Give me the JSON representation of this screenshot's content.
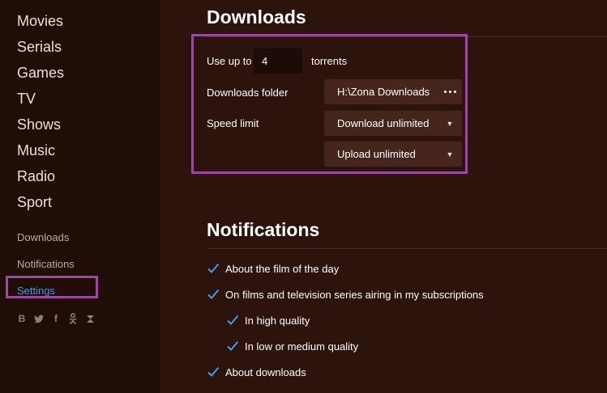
{
  "sidebar": {
    "main_items": [
      "Movies",
      "Serials",
      "Games",
      "TV",
      "Shows",
      "Music",
      "Radio",
      "Sport"
    ],
    "sub_items": [
      "Downloads",
      "Notifications",
      "Settings"
    ],
    "active_item": "Settings",
    "social_icons": [
      "B",
      "twitter-icon",
      "f",
      "odnoklassniki-icon",
      "zona-icon"
    ]
  },
  "downloads": {
    "title": "Downloads",
    "use_up_to_label": "Use up to",
    "torrents_value": "4",
    "torrents_label": "torrents",
    "folder_label": "Downloads folder",
    "folder_value": "H:\\Zona Downloads",
    "speed_label": "Speed limit",
    "download_limit": "Download unlimited",
    "upload_limit": "Upload unlimited"
  },
  "notifications": {
    "title": "Notifications",
    "options": [
      {
        "label": "About the film of the day",
        "checked": true
      },
      {
        "label": "On films and television series airing in my subscriptions",
        "checked": true
      },
      {
        "label": "In high quality",
        "checked": true
      },
      {
        "label": "In low or medium quality",
        "checked": true
      },
      {
        "label": "About downloads",
        "checked": true
      }
    ]
  },
  "colors": {
    "accent": "#3d9cf0",
    "highlight": "#9b4aa1",
    "background": "#2c130c",
    "sidebar": "#200d08"
  }
}
